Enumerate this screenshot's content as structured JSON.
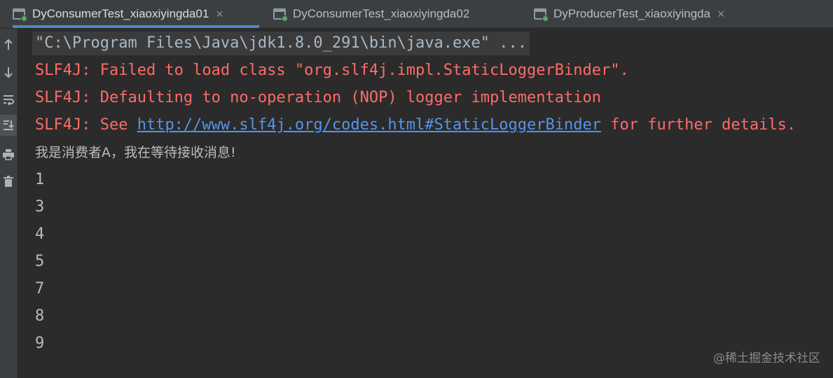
{
  "tabs": [
    {
      "label": "DyConsumerTest_xiaoxiyingda01",
      "active": true,
      "closable": true
    },
    {
      "label": "DyConsumerTest_xiaoxiyingda02",
      "active": false,
      "closable": false
    },
    {
      "label": "DyProducerTest_xiaoxiyingda",
      "active": false,
      "closable": true
    }
  ],
  "close_glyph": "×",
  "toolbar": {
    "items": [
      "arrow-up-icon",
      "arrow-down-icon",
      "soft-wrap-icon",
      "scroll-to-end-icon",
      "print-icon",
      "trash-icon"
    ]
  },
  "console": {
    "command": "\"C:\\Program Files\\Java\\jdk1.8.0_291\\bin\\java.exe\" ...",
    "err1": "SLF4J: Failed to load class \"org.slf4j.impl.StaticLoggerBinder\".",
    "err2": "SLF4J: Defaulting to no-operation (NOP) logger implementation",
    "err3_prefix": "SLF4J: See ",
    "err3_link": "http://www.slf4j.org/codes.html#StaticLoggerBinder",
    "err3_suffix": " for further details.",
    "message": "我是消费者A，我在等待接收消息!",
    "numbers": [
      "1",
      "3",
      "4",
      "5",
      "7",
      "8",
      "9"
    ]
  },
  "watermark": "@稀土掘金技术社区",
  "colors": {
    "background": "#2b2b2b",
    "error": "#ff6b68",
    "link": "#5394ec",
    "active_tab_underline": "#4a88c7"
  }
}
